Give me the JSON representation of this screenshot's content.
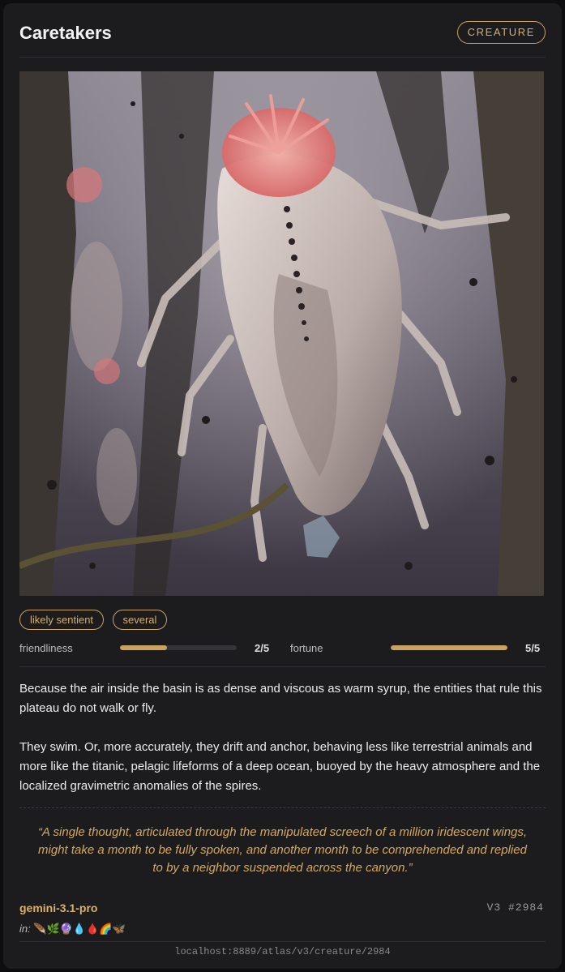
{
  "header": {
    "title": "Caretakers",
    "badge": "CREATURE"
  },
  "image": {
    "icon": "creature-illustration"
  },
  "tags": [
    "likely sentient",
    "several"
  ],
  "stats": [
    {
      "label": "friendliness",
      "value_text": "2/5",
      "level": 0.4
    },
    {
      "label": "fortune",
      "value_text": "5/5",
      "level": 1.0
    }
  ],
  "description": [
    "Because the air inside the basin is as dense and viscous as warm syrup, the entities that rule this plateau do not walk or fly.",
    "They swim. Or, more accurately, they drift and anchor, behaving less like terrestrial animals and more like the titanic, pelagic lifeforms of a deep ocean, buoyed by the heavy atmosphere and the localized gravimetric anomalies of the spires."
  ],
  "quote": "“A single thought, articulated through the manipulated screech of a million iridescent wings, might take a month to be fully spoken, and another month to be comprehended and replied to by a neighbor suspended across the canyon.”",
  "footer": {
    "model": "gemini-3.1-pro",
    "version": "V3 #2984",
    "in_label": "in:",
    "in_icons": "🪶🌿🔮💧🩸🌈🦋",
    "url": "localhost:8889/atlas/v3/creature/2984"
  },
  "colors": {
    "accent": "#c9a35f",
    "background": "#1c1c1f"
  }
}
